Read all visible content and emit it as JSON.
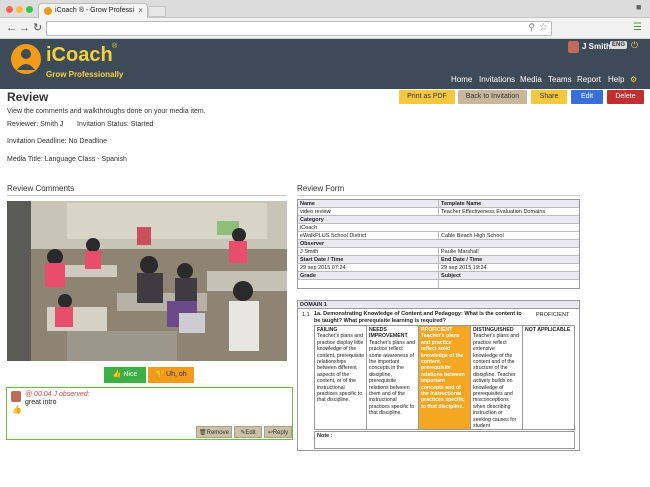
{
  "browser": {
    "tab_title": "iCoach ® - Grow Professi",
    "close_glyph": "×"
  },
  "app": {
    "logo_text": "iCoach",
    "logo_mark": "®",
    "tagline": "Grow Professionally",
    "user_name": "J Smith",
    "language": "ENG",
    "nav": [
      "Home",
      "Invitations",
      "Media",
      "Teams",
      "Report",
      "Help"
    ]
  },
  "page": {
    "title": "Review",
    "description": "View the comments and walkthroughs done on your media item.",
    "buttons": {
      "print": "Print as PDF",
      "back": "Back to Invitation",
      "share": "Share",
      "edit": "Edit",
      "delete": "Delete"
    },
    "reviewer_label": "Reviewer:",
    "reviewer": "Smith J",
    "status_label": "Invitation Status:",
    "status": "Started",
    "deadline_label": "Invitation Deadline:",
    "deadline": "No Deadline",
    "media_label": "Media Title:",
    "media_title": "Language Class - Spanish"
  },
  "comments": {
    "heading": "Review Comments",
    "nice": "Nice",
    "uhoh": "Uh, oh",
    "items": [
      {
        "meta": "@ 00:04 J observed:",
        "text": "great intro",
        "remove": "Remove",
        "edit": "Edit",
        "reply": "Reply"
      }
    ]
  },
  "form": {
    "heading": "Review Form",
    "name_label": "Name",
    "template_label": "Template Name",
    "name": "video review",
    "template": "Teacher Effectiveness Evaluation Domains",
    "category_label": "Category",
    "category": "iCoach",
    "district": "eWalkPLUS School District",
    "school": "Cable Beach High School",
    "observer_label": "Observer",
    "observer": "J Smith",
    "observed": "Paulie Marshall",
    "start_label": "Start Date / Time",
    "end_label": "End Date / Time",
    "start": "29 sep 2015 07:24",
    "end": "29 sep 2015 19:24",
    "grade_label": "Grade",
    "subject_label": "Subject",
    "domain_title": "DOMAIN 1",
    "criterion_num": "1.1",
    "criterion_title": "1a. Demonstrating Knowledge of Content and Pedagogy: What is the content to be taught? What prerequisite learning is required?",
    "criterion_rating": "PROFICIENT",
    "rubric": [
      {
        "head": "FAILING",
        "text": "Teacher's plans and practice display little knowledge of the content, prerequisite relationships between different aspects of the content, or of the instructional practices specific to that discipline."
      },
      {
        "head": "NEEDS IMPROVEMENT",
        "text": "Teacher's plans and practice reflect some awareness of the important concepts in the discipline, prerequisite relations between them and of the instructional practices specific to that discipline."
      },
      {
        "head": "PROFICIENT",
        "text": "Teacher's plans and practice reflect solid knowledge of the content, prerequisite relations between important concepts and of the instructional practices specific to that discipline."
      },
      {
        "head": "DISTINGUISHED",
        "text": "Teacher's plans and practice reflect extensive knowledge of the content and of the structure of the discipline. Teacher actively builds on knowledge of prerequisites and misconceptions when describing instruction or seeking causes for student misunderstanding."
      },
      {
        "head": "NOT APPLICABLE",
        "text": ""
      }
    ],
    "note_label": "Note :"
  },
  "colors": {
    "header_bg": "#3d4a58",
    "brand_yellow": "#f5d23a",
    "print_btn": "#f5c842",
    "back_btn": "#c9b79c",
    "share_btn": "#f5c842",
    "edit_btn": "#3a6fd8",
    "delete_btn": "#c03030",
    "nice_btn": "#3cb043",
    "uhoh_btn": "#f29b1b",
    "proficient": "#f5a623"
  }
}
